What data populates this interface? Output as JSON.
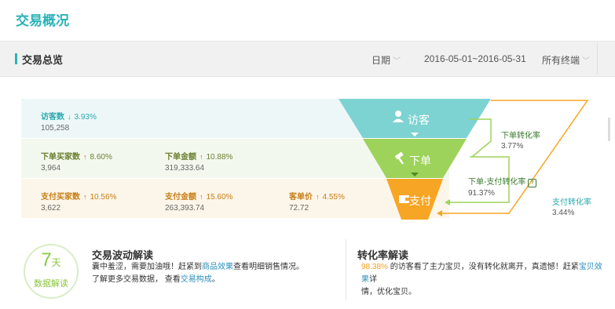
{
  "page": {
    "title": "交易概况"
  },
  "header": {
    "section_title": "交易总览",
    "date_label": "日期",
    "date_range": "2016-05-01~2016-05-31",
    "terminal_label": "所有终端"
  },
  "metrics": {
    "visitor": {
      "label": "访客数",
      "pct": "3.93%",
      "trend": "down",
      "value": "105,258"
    },
    "buyers": {
      "label": "下单买家数",
      "pct": "8.60%",
      "trend": "up",
      "value": "3,964"
    },
    "order_amount": {
      "label": "下单金额",
      "pct": "10.88%",
      "trend": "up",
      "value": "319,333.64"
    },
    "pay_buyers": {
      "label": "支付买家数",
      "pct": "10.56%",
      "trend": "up",
      "value": "3,622"
    },
    "pay_amount": {
      "label": "支付金额",
      "pct": "15.60%",
      "trend": "up",
      "value": "263,393.74"
    },
    "unit_price": {
      "label": "客单价",
      "pct": "4.55%",
      "trend": "up",
      "value": "72.72"
    }
  },
  "funnel": {
    "visitor_label": "访客",
    "order_label": "下单",
    "pay_label": "支付",
    "colors": {
      "visitor": "#7dd3d1",
      "order": "#9dd35a",
      "pay": "#f7a524"
    }
  },
  "rates": {
    "order_rate": {
      "label": "下单转化率",
      "value": "3.77%"
    },
    "order_pay_rate": {
      "label": "下单-支付转化率",
      "value": "91.37%"
    },
    "pay_rate": {
      "label": "支付转化率",
      "value": "3.44%"
    }
  },
  "badge": {
    "num": "7",
    "unit": "天",
    "text": "数据解读"
  },
  "wave": {
    "title": "交易波动解读",
    "line1_a": "囊中羞涩，需要加油哦！赶紧到",
    "line1_link": "商品效果",
    "line1_b": "查看明细销售情况。",
    "line2_a": "了解更多交易数据，  查看",
    "line2_link": "交易构成",
    "line2_b": "。"
  },
  "conversion": {
    "title": "转化率解读",
    "pct": "98.38%",
    "text_a": " 的访客看了主力宝贝，没有转化就离开，真遗憾！赶紧",
    "link": "宝贝效果",
    "text_b": "详",
    "line2": "情，优化宝贝。"
  }
}
